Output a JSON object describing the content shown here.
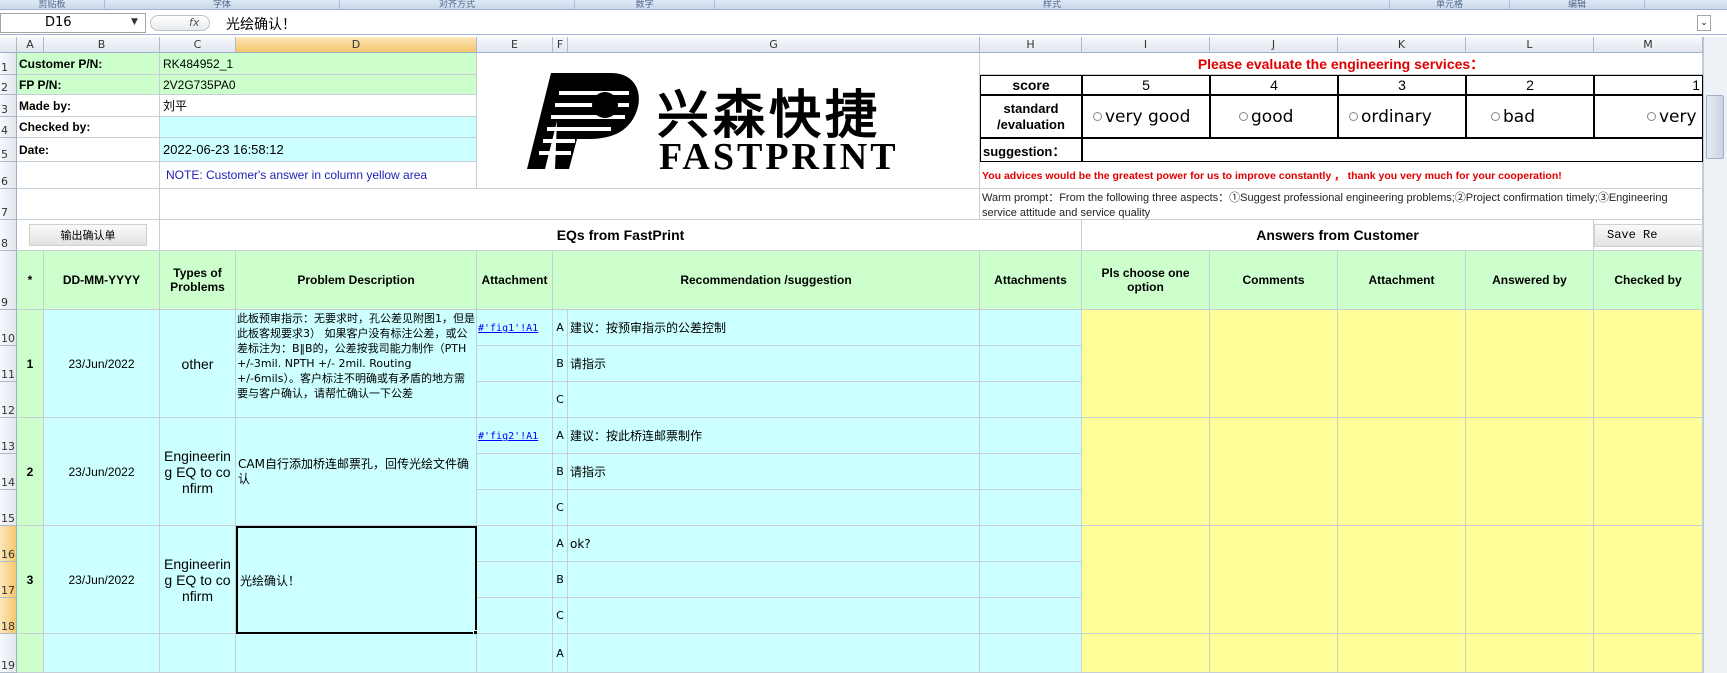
{
  "ribbon": {
    "groups": [
      "剪贴板",
      "字体",
      "对齐方式",
      "数字",
      "样式",
      "单元格",
      "编辑"
    ]
  },
  "formula_bar": {
    "name_box": "D16",
    "fx": "fx",
    "content": "光绘确认！"
  },
  "columns": [
    "A",
    "B",
    "C",
    "D",
    "E",
    "F",
    "G",
    "H",
    "I",
    "J",
    "K",
    "L",
    "M"
  ],
  "rows": [
    "1",
    "2",
    "3",
    "4",
    "5",
    "6",
    "7",
    "8",
    "9",
    "10",
    "11",
    "12",
    "13",
    "14",
    "15",
    "16",
    "17",
    "18",
    "19"
  ],
  "header_info": {
    "customer_pn_label": "Customer P/N:",
    "customer_pn": "RK484952_1",
    "fp_pn_label": "FP P/N:",
    "fp_pn": "2V2G735PA0",
    "made_by_label": "Made by:",
    "made_by": "刘平",
    "checked_by_label": "Checked by:",
    "checked_by": "",
    "date_label": "Date:",
    "date": "2022-06-23 16:58:12",
    "note": "NOTE: Customer's  answer in column yellow area"
  },
  "logo": {
    "chinese": "兴森快捷",
    "english": "FASTPRINT"
  },
  "evaluation": {
    "title": "Please evaluate the engineering services：",
    "score_label": "score",
    "scores": [
      "5",
      "4",
      "3",
      "2",
      "1"
    ],
    "standard_label": "standard /evaluation",
    "options": [
      "very good",
      "good",
      "ordinary",
      "bad",
      "very"
    ],
    "suggestion_label": "suggestion："
  },
  "advice": "You advices would be the greatest power for us to improve constantly ，  thank you very much for your cooperation!",
  "prompt": "Warm prompt：From the following three aspects：①Suggest professional engineering problems;②Project confirmation timely;③Engineering service attitude and service quality",
  "buttons": {
    "export": "输出确认单",
    "save": "Save Re"
  },
  "sections": {
    "eqs": "EQs from FastPrint",
    "answers": "Answers from Customer"
  },
  "table_headers": {
    "star": "*",
    "date": "DD-MM-YYYY",
    "types": "Types of Problems",
    "problem": "Problem Description",
    "attachment": "Attachment",
    "recommendation": "Recommendation /suggestion",
    "attachments": "Attachments",
    "choose": "Pls choose one option",
    "comments": "Comments",
    "attachment2": "Attachment",
    "answered_by": "Answered by",
    "checked_by": "Checked by"
  },
  "eqs": [
    {
      "num": "1",
      "date": "23/Jun/2022",
      "type": "other",
      "problem": "此板预审指示：无要求时，孔公差见附图1，但是此板客规要求3） 如果客户没有标注公差，或公差标注为：B‖B的，公差按我司能力制作（PTH +/-3mil. NPTH +/- 2mil. Routing +/-6mils）。客户标注不明确或有矛盾的地方需要与客户确认，请帮忙确认一下公差",
      "link": "#'fig1'!A1",
      "options": [
        {
          "letter": "A",
          "text": "建议：按预审指示的公差控制"
        },
        {
          "letter": "B",
          "text": "请指示"
        },
        {
          "letter": "C",
          "text": ""
        }
      ]
    },
    {
      "num": "2",
      "date": "23/Jun/2022",
      "type": "Engineering EQ to confirm",
      "problem": "CAM自行添加桥连邮票孔，回传光绘文件确认",
      "link": "#'fig2'!A1",
      "options": [
        {
          "letter": "A",
          "text": "建议：按此桥连邮票制作"
        },
        {
          "letter": "B",
          "text": "请指示"
        },
        {
          "letter": "C",
          "text": ""
        }
      ]
    },
    {
      "num": "3",
      "date": "23/Jun/2022",
      "type": "Engineering EQ to confirm",
      "problem": "光绘确认！",
      "link": "",
      "options": [
        {
          "letter": "A",
          "text": "ok?"
        },
        {
          "letter": "B",
          "text": ""
        },
        {
          "letter": "C",
          "text": ""
        }
      ]
    }
  ],
  "row19_letter": "A"
}
